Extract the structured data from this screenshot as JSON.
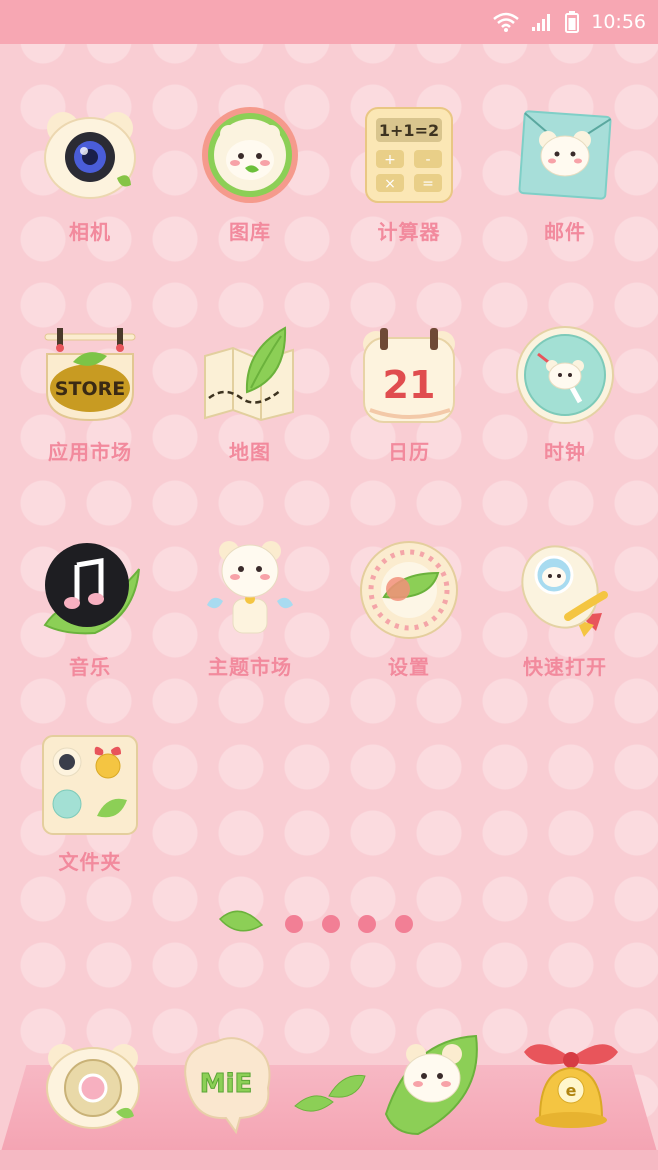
{
  "status_bar": {
    "time": "10:56"
  },
  "apps": [
    {
      "label": "相机"
    },
    {
      "label": "图库"
    },
    {
      "label": "计算器"
    },
    {
      "label": "邮件"
    },
    {
      "label": "应用市场"
    },
    {
      "label": "地图"
    },
    {
      "label": "日历"
    },
    {
      "label": "时钟"
    },
    {
      "label": "音乐"
    },
    {
      "label": "主题市场"
    },
    {
      "label": "设置"
    },
    {
      "label": "快速打开"
    },
    {
      "label": "文件夹"
    }
  ],
  "icon_text": {
    "calculator_display": "1+1=2",
    "store_sign": "STORE",
    "calendar_day": "21",
    "dock_mie": "MiE",
    "bell_letter": "e"
  },
  "colors": {
    "status_bar": "#f7a7b3",
    "label": "#f28a9d",
    "background": "#f9cdd3",
    "page_dot": "#f27f95"
  }
}
